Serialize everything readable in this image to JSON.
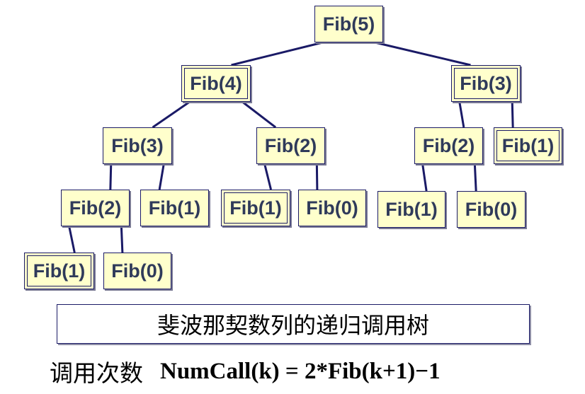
{
  "tree": {
    "nodes": [
      {
        "id": "n5",
        "label": "Fib(5)"
      },
      {
        "id": "n4",
        "label": "Fib(4)"
      },
      {
        "id": "n3",
        "label": "Fib(3)"
      },
      {
        "id": "n4_3",
        "label": "Fib(3)"
      },
      {
        "id": "n4_2",
        "label": "Fib(2)"
      },
      {
        "id": "n3_2",
        "label": "Fib(2)"
      },
      {
        "id": "n3_1",
        "label": "Fib(1)"
      },
      {
        "id": "n4_3_2",
        "label": "Fib(2)"
      },
      {
        "id": "n4_3_1",
        "label": "Fib(1)"
      },
      {
        "id": "n4_2_1",
        "label": "Fib(1)"
      },
      {
        "id": "n4_2_0",
        "label": "Fib(0)"
      },
      {
        "id": "n3_2_1",
        "label": "Fib(1)"
      },
      {
        "id": "n3_2_0",
        "label": "Fib(0)"
      },
      {
        "id": "n4_3_2_1",
        "label": "Fib(1)"
      },
      {
        "id": "n4_3_2_0",
        "label": "Fib(0)"
      }
    ],
    "edges": [
      [
        "n5",
        "n4"
      ],
      [
        "n5",
        "n3"
      ],
      [
        "n4",
        "n4_3"
      ],
      [
        "n4",
        "n4_2"
      ],
      [
        "n3",
        "n3_2"
      ],
      [
        "n3",
        "n3_1"
      ],
      [
        "n4_3",
        "n4_3_2"
      ],
      [
        "n4_3",
        "n4_3_1"
      ],
      [
        "n4_2",
        "n4_2_1"
      ],
      [
        "n4_2",
        "n4_2_0"
      ],
      [
        "n3_2",
        "n3_2_1"
      ],
      [
        "n3_2",
        "n3_2_0"
      ],
      [
        "n4_3_2",
        "n4_3_2_1"
      ],
      [
        "n4_3_2",
        "n4_3_2_0"
      ]
    ]
  },
  "caption": "斐波那契数列的递归调用树",
  "formula": {
    "label": "调用次数",
    "expression": "NumCall(k) = 2*Fib(k+1)−1"
  },
  "colors": {
    "node_fill": "#ffffcc",
    "node_border": "#1a1a66",
    "edge": "#1a1a66",
    "node_text": "#2f3a5a"
  }
}
